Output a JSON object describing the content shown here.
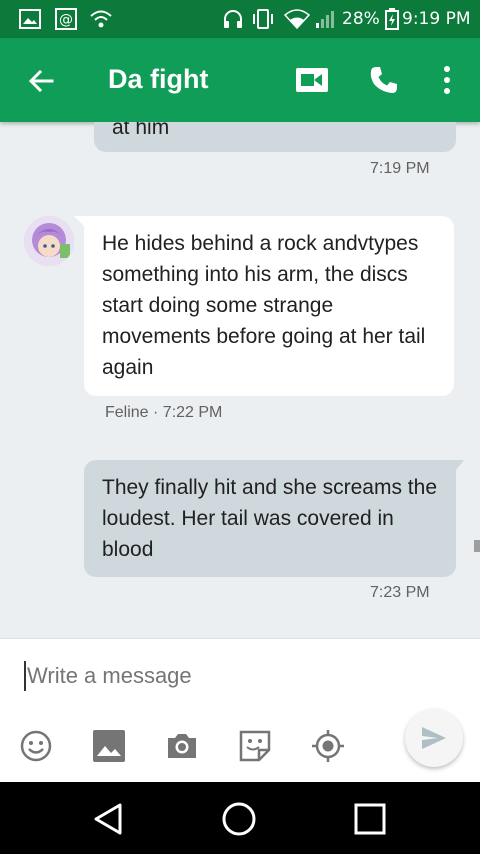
{
  "status_bar": {
    "battery_percent": "28%",
    "time": "9:19 PM",
    "icons": [
      "image-icon",
      "at-icon",
      "wifi-call-icon",
      "headset-icon",
      "vibrate-icon",
      "wifi-icon",
      "signal-icon",
      "battery-charging-icon"
    ]
  },
  "app_bar": {
    "title": "Da fight",
    "icons": [
      "back-arrow-icon",
      "video-call-icon",
      "phone-icon",
      "more-vert-icon"
    ]
  },
  "messages": [
    {
      "direction": "out",
      "text": "at him",
      "time": "7:19 PM"
    },
    {
      "direction": "in",
      "text": "He hides behind a rock andvtypes something into his arm, the discs start doing some strange movements before going at her tail again",
      "sender": "Feline",
      "time": "7:22 PM"
    },
    {
      "direction": "out",
      "text": "They finally hit and she screams the loudest. Her tail was covered in blood",
      "time": "7:23 PM"
    }
  ],
  "msg_meta": {
    "in_meta": "Feline · 7:22 PM"
  },
  "compose": {
    "placeholder": "Write a message",
    "tools": [
      "emoji-icon",
      "gallery-icon",
      "camera-icon",
      "sticker-icon",
      "location-icon",
      "send-icon"
    ]
  },
  "nav_bar": {
    "buttons": [
      "back-triangle-icon",
      "home-circle-icon",
      "recents-square-icon"
    ]
  },
  "colors": {
    "status_bar": "#0b7a3a",
    "app_bar": "#0f9d58",
    "chat_bg": "#eceff1",
    "outgoing_bubble": "#cfd8dc",
    "incoming_bubble": "#ffffff"
  }
}
